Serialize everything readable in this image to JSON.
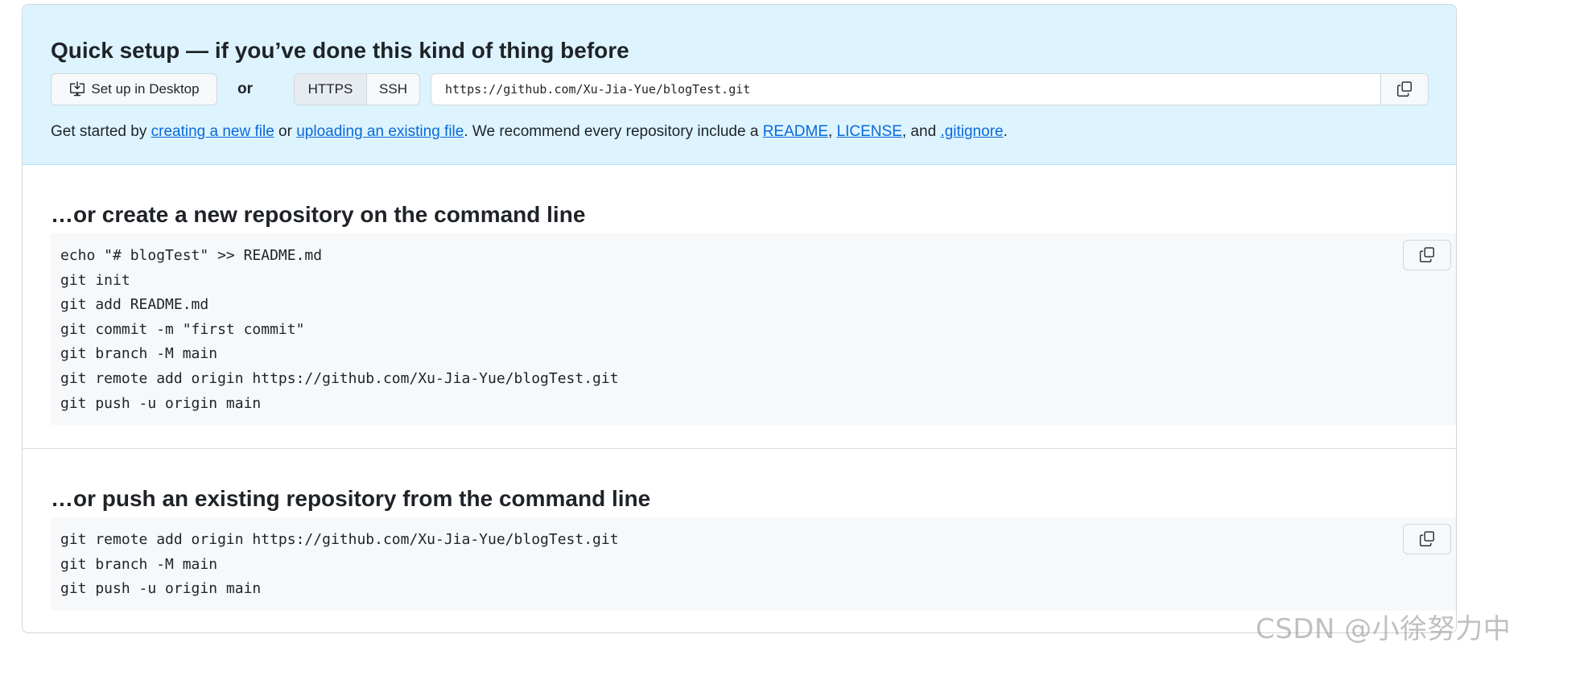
{
  "quick_setup": {
    "title": "Quick setup — if you’ve done this kind of thing before",
    "desktop_button_label": "Set up in Desktop",
    "or_label": "or",
    "protocol_tabs": [
      {
        "label": "HTTPS",
        "selected": true
      },
      {
        "label": "SSH",
        "selected": false
      }
    ],
    "clone_url": "https://github.com/Xu-Jia-Yue/blogTest.git",
    "help": {
      "prefix": "Get started by ",
      "link_new_file": "creating a new file",
      "text_or": " or ",
      "link_upload": "uploading an existing file",
      "text_recommend": ". We recommend every repository include a ",
      "link_readme": "README",
      "comma1": ", ",
      "link_license": "LICENSE",
      "text_and": ", and ",
      "link_gitignore": ".gitignore",
      "suffix": "."
    }
  },
  "new_repo": {
    "title": "…or create a new repository on the command line",
    "code": "echo \"# blogTest\" >> README.md\ngit init\ngit add README.md\ngit commit -m \"first commit\"\ngit branch -M main\ngit remote add origin https://github.com/Xu-Jia-Yue/blogTest.git\ngit push -u origin main"
  },
  "push_existing": {
    "title": "…or push an existing repository from the command line",
    "code": "git remote add origin https://github.com/Xu-Jia-Yue/blogTest.git\ngit branch -M main\ngit push -u origin main"
  },
  "watermark": "CSDN @小徐努力中",
  "colors": {
    "quick_bg": "#ddf4ff",
    "link": "#0969da",
    "code_bg": "#f6f8fa",
    "border": "#d0d7de"
  },
  "icons": {
    "desktop": "desktop-download-icon",
    "copy": "copy-icon"
  }
}
